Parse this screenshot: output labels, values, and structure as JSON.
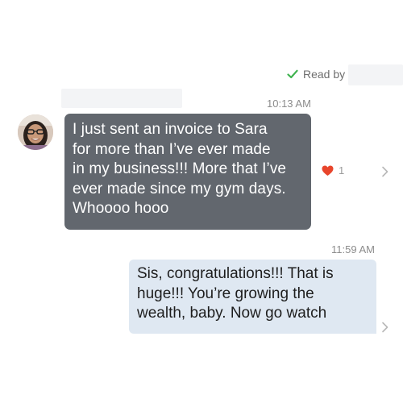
{
  "read_receipt": {
    "label": "Read by"
  },
  "timestamps": {
    "first": "10:13 AM",
    "second": "11:59 AM"
  },
  "incoming_message": {
    "lines": [
      "I just sent an invoice to Sara",
      "for more than I’ve ever made",
      "in my business!!! More that I’ve",
      "ever made since my gym days.",
      "Whoooo hooo"
    ],
    "reaction_icon": "heart-icon",
    "reaction_count": "1"
  },
  "outgoing_message": {
    "lines": [
      "Sis, congratulations!!! That is",
      "huge!!! You’re growing the",
      "wealth, baby. Now go watch"
    ]
  },
  "colors": {
    "incoming_bubble": "#62676e",
    "outgoing_bubble": "#dfe8f2",
    "read_check": "#3fb34f",
    "heart": "#e8452c"
  }
}
